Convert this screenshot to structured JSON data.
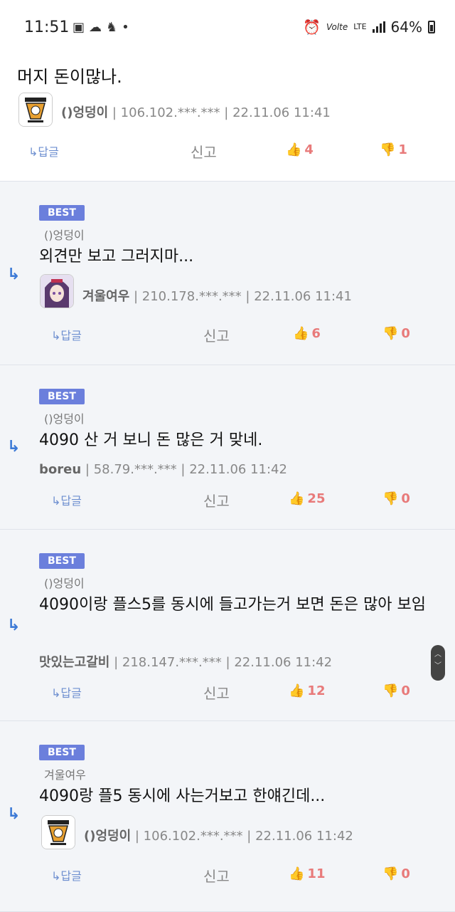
{
  "status_bar": {
    "time": "11:51",
    "left_icons": [
      "image-icon",
      "cloud-icon",
      "figure-icon",
      "dot-icon"
    ],
    "carrier": "Vo",
    "carrier_suffix": "lte",
    "network": "LTE",
    "battery": "64%"
  },
  "top_comment": {
    "text": "머지 돈이많나.",
    "author": "()엉덩이",
    "ip": "106.102.***.***",
    "date": "22.11.06 11:41",
    "reply_label": "답글",
    "report_label": "신고",
    "likes": "4",
    "dislikes": "1"
  },
  "comments": [
    {
      "badge": "BEST",
      "reply_to": "()엉덩이",
      "text": "외견만 보고 그러지마...",
      "author": "겨울여우",
      "ip": "210.178.***.***",
      "date": "22.11.06 11:41",
      "reply_label": "답글",
      "report_label": "신고",
      "likes": "6",
      "dislikes": "0"
    },
    {
      "badge": "BEST",
      "reply_to": "()엉덩이",
      "text": "4090 산 거 보니 돈 많은 거 맞네.",
      "author": "boreu",
      "ip": "58.79.***.***",
      "date": "22.11.06 11:42",
      "reply_label": "답글",
      "report_label": "신고",
      "likes": "25",
      "dislikes": "0"
    },
    {
      "badge": "BEST",
      "reply_to": "()엉덩이",
      "text": "4090이랑 플스5를 동시에 들고가는거 보면 돈은 많아 보임",
      "author": "맛있는고갈비",
      "ip": "218.147.***.***",
      "date": "22.11.06 11:42",
      "reply_label": "답글",
      "report_label": "신고",
      "likes": "12",
      "dislikes": "0"
    },
    {
      "badge": "BEST",
      "reply_to": "겨울여우",
      "text": "4090랑 플5 동시에 사는거보고 한얘긴데...",
      "author": "()엉덩이",
      "ip": "106.102.***.***",
      "date": "22.11.06 11:42",
      "reply_label": "답글",
      "report_label": "신고",
      "likes": "11",
      "dislikes": "0"
    }
  ],
  "colors": {
    "best_badge": "#6b7fdc",
    "like_count": "#e87a7a",
    "reply_link": "#6e8fd0",
    "card_bg": "#f3f5f8"
  }
}
